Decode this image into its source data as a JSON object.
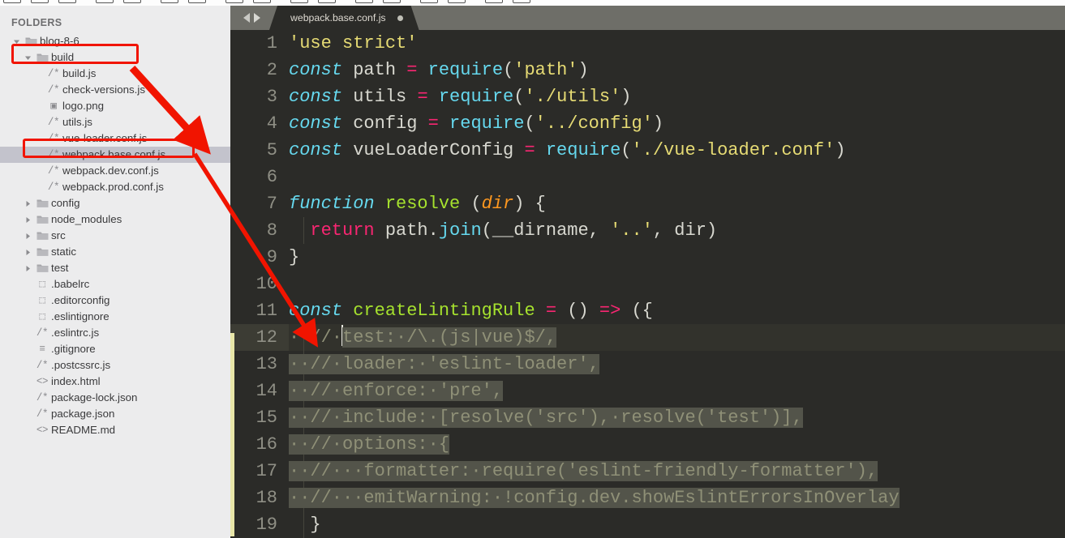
{
  "window": {
    "title": "webpack.base.conf.js"
  },
  "sidebar": {
    "header": "FOLDERS",
    "items": [
      {
        "label": "blog-8-6",
        "type": "folder",
        "depth": 0,
        "expanded": true,
        "icon": "folder-icon"
      },
      {
        "label": "build",
        "type": "folder",
        "depth": 1,
        "expanded": true,
        "icon": "folder-icon"
      },
      {
        "label": "build.js",
        "type": "file",
        "depth": 2,
        "icon": "js-file-icon",
        "glyph": "/*"
      },
      {
        "label": "check-versions.js",
        "type": "file",
        "depth": 2,
        "icon": "js-file-icon",
        "glyph": "/*"
      },
      {
        "label": "logo.png",
        "type": "file",
        "depth": 2,
        "icon": "image-file-icon",
        "glyph": "▣"
      },
      {
        "label": "utils.js",
        "type": "file",
        "depth": 2,
        "icon": "js-file-icon",
        "glyph": "/*"
      },
      {
        "label": "vue-loader.conf.js",
        "type": "file",
        "depth": 2,
        "icon": "js-file-icon",
        "glyph": "/*"
      },
      {
        "label": "webpack.base.conf.js",
        "type": "file",
        "depth": 2,
        "icon": "js-file-icon",
        "glyph": "/*",
        "selected": true
      },
      {
        "label": "webpack.dev.conf.js",
        "type": "file",
        "depth": 2,
        "icon": "js-file-icon",
        "glyph": "/*"
      },
      {
        "label": "webpack.prod.conf.js",
        "type": "file",
        "depth": 2,
        "icon": "js-file-icon",
        "glyph": "/*"
      },
      {
        "label": "config",
        "type": "folder",
        "depth": 1,
        "expanded": false,
        "icon": "folder-icon"
      },
      {
        "label": "node_modules",
        "type": "folder",
        "depth": 1,
        "expanded": false,
        "icon": "folder-icon"
      },
      {
        "label": "src",
        "type": "folder",
        "depth": 1,
        "expanded": false,
        "icon": "folder-icon"
      },
      {
        "label": "static",
        "type": "folder",
        "depth": 1,
        "expanded": false,
        "icon": "folder-icon"
      },
      {
        "label": "test",
        "type": "folder",
        "depth": 1,
        "expanded": false,
        "icon": "folder-icon"
      },
      {
        "label": ".babelrc",
        "type": "file",
        "depth": 1,
        "icon": "plain-file-icon",
        "glyph": "⬚"
      },
      {
        "label": ".editorconfig",
        "type": "file",
        "depth": 1,
        "icon": "plain-file-icon",
        "glyph": "⬚"
      },
      {
        "label": ".eslintignore",
        "type": "file",
        "depth": 1,
        "icon": "plain-file-icon",
        "glyph": "⬚"
      },
      {
        "label": ".eslintrc.js",
        "type": "file",
        "depth": 1,
        "icon": "js-file-icon",
        "glyph": "/*"
      },
      {
        "label": ".gitignore",
        "type": "file",
        "depth": 1,
        "icon": "text-file-icon",
        "glyph": "≡"
      },
      {
        "label": ".postcssrc.js",
        "type": "file",
        "depth": 1,
        "icon": "js-file-icon",
        "glyph": "/*"
      },
      {
        "label": "index.html",
        "type": "file",
        "depth": 1,
        "icon": "html-file-icon",
        "glyph": "<>"
      },
      {
        "label": "package-lock.json",
        "type": "file",
        "depth": 1,
        "icon": "js-file-icon",
        "glyph": "/*"
      },
      {
        "label": "package.json",
        "type": "file",
        "depth": 1,
        "icon": "js-file-icon",
        "glyph": "/*"
      },
      {
        "label": "README.md",
        "type": "file",
        "depth": 1,
        "icon": "html-file-icon",
        "glyph": "<>"
      }
    ]
  },
  "tabbar": {
    "nav_back": "◀",
    "nav_forward": "▶",
    "tabs": [
      {
        "label": "webpack.base.conf.js",
        "dirty": true,
        "active": true
      }
    ]
  },
  "editor": {
    "first_line": 1,
    "active_line": 12,
    "lines": [
      {
        "n": "1",
        "text": "'use strict'"
      },
      {
        "n": "2",
        "text": "const path = require('path')"
      },
      {
        "n": "3",
        "text": "const utils = require('./utils')"
      },
      {
        "n": "4",
        "text": "const config = require('../config')"
      },
      {
        "n": "5",
        "text": "const vueLoaderConfig = require('./vue-loader.conf')"
      },
      {
        "n": "6",
        "text": ""
      },
      {
        "n": "7",
        "text": "function resolve (dir) {"
      },
      {
        "n": "8",
        "text": "  return path.join(__dirname, '..', dir)"
      },
      {
        "n": "9",
        "text": "}"
      },
      {
        "n": "10",
        "text": ""
      },
      {
        "n": "11",
        "text": "const createLintingRule = () => ({"
      },
      {
        "n": "12",
        "text": "  // test: /\\.(js|vue)$/,"
      },
      {
        "n": "13",
        "text": "  // loader: 'eslint-loader',"
      },
      {
        "n": "14",
        "text": "  // enforce: 'pre',"
      },
      {
        "n": "15",
        "text": "  // include: [resolve('src'), resolve('test')],"
      },
      {
        "n": "16",
        "text": "  // options: {"
      },
      {
        "n": "17",
        "text": "  //   formatter: require('eslint-friendly-formatter'),"
      },
      {
        "n": "18",
        "text": "  //   emitWarning: !config.dev.showEslintErrorsInOverlay"
      },
      {
        "n": "19",
        "text": "  }"
      }
    ]
  },
  "annotations": {
    "color": "#f11400",
    "boxes": [
      {
        "name": "highlight-build-folder",
        "label": "build"
      },
      {
        "name": "highlight-webpack-base-conf",
        "label": "webpack.base.conf.js"
      }
    ],
    "arrows": [
      {
        "name": "arrow-build-to-file",
        "from": "build folder",
        "to": "webpack.base.conf.js"
      },
      {
        "name": "arrow-file-to-line12",
        "from": "webpack.base.conf.js",
        "to": "line 12"
      }
    ]
  },
  "colors": {
    "sidebar_bg": "#ececed",
    "sidebar_selected": "#c3c3cc",
    "editor_bg": "#2b2b28",
    "tabbar_bg": "#6e6e68",
    "annotation_red": "#f11400",
    "modified_marker": "#e8e6a8",
    "keyword": "#66d9ef",
    "string": "#e6db74",
    "function": "#a6e22e",
    "operator": "#f92672",
    "parameter": "#fd971f",
    "comment": "#8f9077",
    "selection": "#53544a"
  }
}
